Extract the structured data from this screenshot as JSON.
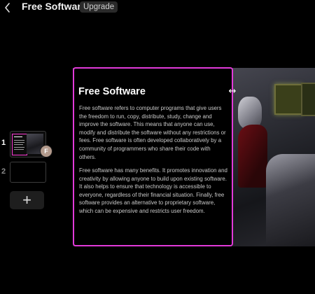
{
  "header": {
    "title": "Free Software",
    "upgrade_label": "Upgrade"
  },
  "slides_rail": {
    "items": [
      {
        "number": "1",
        "avatar_initial": "F"
      },
      {
        "number": "2"
      }
    ],
    "add_label": "+"
  },
  "slide": {
    "title": "Free Software",
    "paragraphs": [
      "Free software refers to computer programs that give users the freedom to run, copy, distribute, study, change and improve the software. This means that anyone can use, modify and distribute the software without any restrictions or fees. Free software is often developed collaboratively by a community of programmers who share their code with others.",
      "Free software has many benefits. It promotes innovation and creativity by allowing anyone to build upon existing software. It also helps to ensure that technology is accessible to everyone, regardless of their financial situation. Finally, free software provides an alternative to proprietary software, which can be expensive and restricts user freedom."
    ]
  },
  "colors": {
    "background": "#000000",
    "selection_accent": "#e23ad9",
    "body_text": "#c9c9c9",
    "upgrade_badge": "#2a2a2a"
  },
  "icons": {
    "back": "chevron-left-icon",
    "resize": "horizontal-resize-icon",
    "add": "plus-icon"
  }
}
